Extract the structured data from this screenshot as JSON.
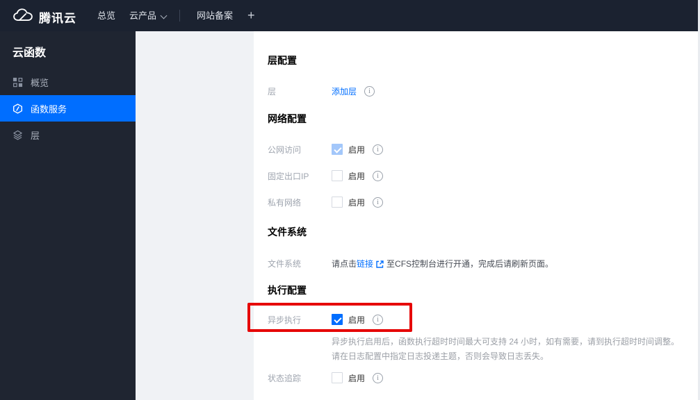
{
  "topnav": {
    "brand": "腾讯云",
    "items": [
      {
        "label": "总览"
      },
      {
        "label": "云产品",
        "has_caret": true
      },
      {
        "label": "网站备案"
      }
    ],
    "plus": "+"
  },
  "sidebar": {
    "title": "云函数",
    "items": [
      {
        "label": "概览",
        "icon": "grid-icon",
        "active": false
      },
      {
        "label": "函数服务",
        "icon": "function-icon",
        "active": true
      },
      {
        "label": "层",
        "icon": "layers-icon",
        "active": false
      }
    ]
  },
  "main": {
    "layer_config": {
      "title": "层配置",
      "layer_label": "层",
      "add_layer_link": "添加层"
    },
    "network_config": {
      "title": "网络配置",
      "public_access_label": "公网访问",
      "fixed_ip_label": "固定出口IP",
      "private_network_label": "私有网络"
    },
    "file_system": {
      "title": "文件系统",
      "label": "文件系统",
      "text_prefix": "请点击",
      "link_text": "链接",
      "text_suffix": "至CFS控制台进行开通，完成后请刷新页面。"
    },
    "execution_config": {
      "title": "执行配置",
      "async_label": "异步执行",
      "async_desc_line1": "异步执行启用后，函数执行超时时间最大可支持 24 小时，如有需要，请到执行超时时间调整。",
      "async_desc_line2": "请在日志配置中指定日志投递主题，否则会导致日志丢失。",
      "status_tracking_label": "状态追踪"
    },
    "enable_label": "启用",
    "checkbox_states": {
      "public_access": "checked-disabled",
      "fixed_ip": "unchecked",
      "private_network": "unchecked",
      "async_execution": "checked",
      "status_tracking": "unchecked"
    }
  },
  "icons": {
    "info": "i"
  },
  "colors": {
    "accent_blue": "#006eff",
    "topnav_bg": "#1b2230",
    "sidebar_bg": "#1f2531",
    "gray_panel": "#f0f2f5",
    "annotation_red": "#e60505",
    "checkbox_disabled_checked": "#a3c7fa"
  }
}
